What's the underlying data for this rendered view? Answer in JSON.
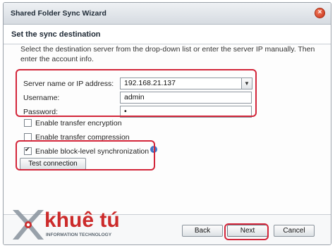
{
  "window": {
    "title": "Shared Folder Sync Wizard"
  },
  "header": {
    "section_title": "Set the sync destination",
    "description": "Select the destination server from the drop-down list or enter the server IP manually. Then enter the account info."
  },
  "form": {
    "server": {
      "label": "Server name or IP address:",
      "value": "192.168.21.137"
    },
    "username": {
      "label": "Username:",
      "value": "admin"
    },
    "password": {
      "label": "Password:",
      "value": "•"
    }
  },
  "options": [
    {
      "label": "Enable transfer encryption",
      "checked": false
    },
    {
      "label": "Enable transfer compression",
      "checked": false
    },
    {
      "label": "Enable block-level synchronization",
      "checked": true
    }
  ],
  "buttons": {
    "test_connection": "Test connection",
    "back": "Back",
    "next": "Next",
    "cancel": "Cancel"
  },
  "watermark": {
    "brand": "khuê tú",
    "tagline": "INFORMATION TECHNOLOGY"
  },
  "colors": {
    "highlight": "#d3263a",
    "info_icon": "#3f78c8",
    "brand_red": "#cc2b2b"
  },
  "icons": {
    "close": "close-icon",
    "dropdown": "chevron-down-icon",
    "info": "info-icon"
  }
}
